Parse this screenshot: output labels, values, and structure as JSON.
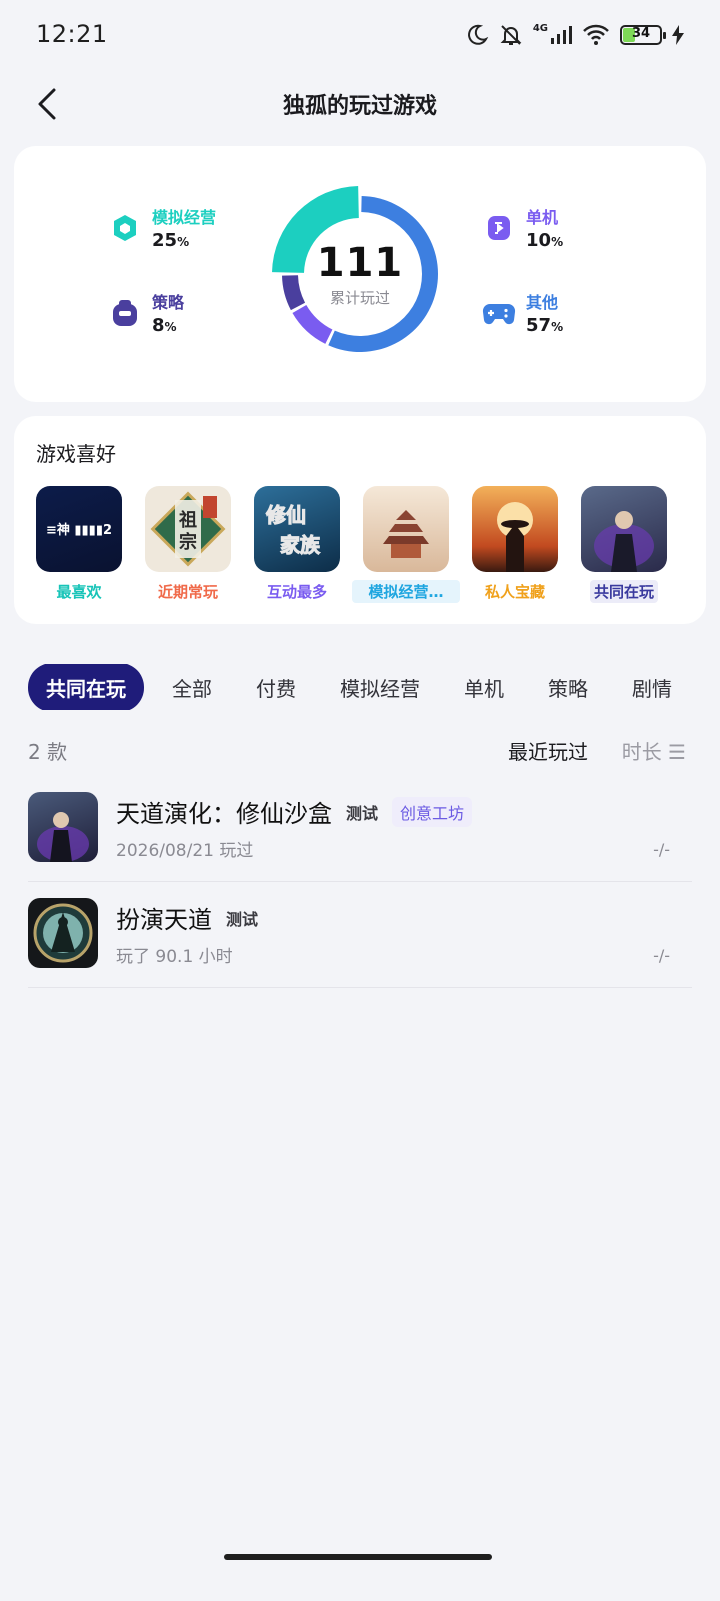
{
  "status": {
    "time": "12:21",
    "battery": "34",
    "network": "4G"
  },
  "header": {
    "title": "独孤的玩过游戏"
  },
  "stats": {
    "total": "111",
    "total_label": "累计玩过",
    "categories": [
      {
        "name": "模拟经营",
        "value": "25",
        "unit": "%",
        "color": "#1ccfc0",
        "percent": 25
      },
      {
        "name": "策略",
        "value": "8",
        "unit": "%",
        "color": "#4a3f9e",
        "percent": 8
      },
      {
        "name": "单机",
        "value": "10",
        "unit": "%",
        "color": "#7a5cf0",
        "percent": 10
      },
      {
        "name": "其他",
        "value": "57",
        "unit": "%",
        "color": "#3d7fe0",
        "percent": 57
      }
    ]
  },
  "preferences": {
    "title": "游戏喜好",
    "items": [
      {
        "tag": "最喜欢",
        "color": "#17c4b8",
        "bg": "#e7f9f7",
        "icon": "game-cover-icon"
      },
      {
        "tag": "近期常玩",
        "color": "#f06a4a",
        "bg": "#fdeee9",
        "icon": "game-cover-icon"
      },
      {
        "tag": "互动最多",
        "color": "#7a5cf0",
        "bg": "#efebfd",
        "icon": "game-cover-icon"
      },
      {
        "tag": "模拟经营…",
        "color": "#1fa6e0",
        "bg": "#e5f4fc",
        "icon": "game-cover-icon"
      },
      {
        "tag": "私人宝藏",
        "color": "#f0a11c",
        "bg": "#fdf3e2",
        "icon": "game-cover-icon"
      },
      {
        "tag": "共同在玩",
        "color": "#3a3a9e",
        "bg": "#ececf8",
        "icon": "game-cover-icon"
      }
    ]
  },
  "tabs": [
    "共同在玩",
    "全部",
    "付费",
    "模拟经营",
    "单机",
    "策略",
    "剧情"
  ],
  "list": {
    "count": "2 款",
    "sort_recent": "最近玩过",
    "sort_duration": "时长 ☰"
  },
  "games": [
    {
      "name": "天道演化：修仙沙盒",
      "badge": "测试",
      "workshop": "创意工坊",
      "sub": "2026/08/21 玩过",
      "right": "-/-"
    },
    {
      "name": "扮演天道",
      "badge": "测试",
      "sub": "玩了 90.1 小时",
      "right": "-/-"
    }
  ]
}
